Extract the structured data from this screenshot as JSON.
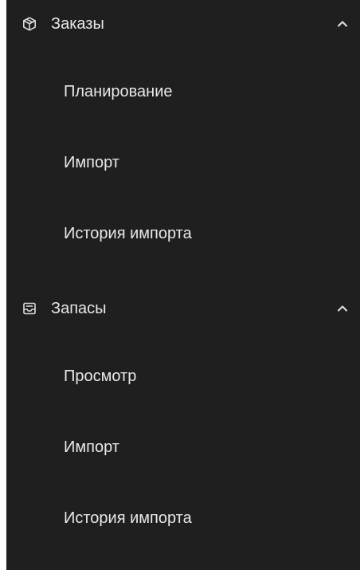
{
  "colors": {
    "sidebar_background": "#1f1f1f",
    "text": "#e8e8e8",
    "icon": "#d9d9d9",
    "page_background": "#ffffff"
  },
  "menu": {
    "groups": [
      {
        "label": "Заказы",
        "icon": "package-icon",
        "expanded": true,
        "items": [
          {
            "label": "Планирование"
          },
          {
            "label": "Импорт"
          },
          {
            "label": "История импорта"
          }
        ]
      },
      {
        "label": "Запасы",
        "icon": "inbox-icon",
        "expanded": true,
        "items": [
          {
            "label": "Просмотр"
          },
          {
            "label": "Импорт"
          },
          {
            "label": "История импорта"
          }
        ]
      }
    ]
  }
}
